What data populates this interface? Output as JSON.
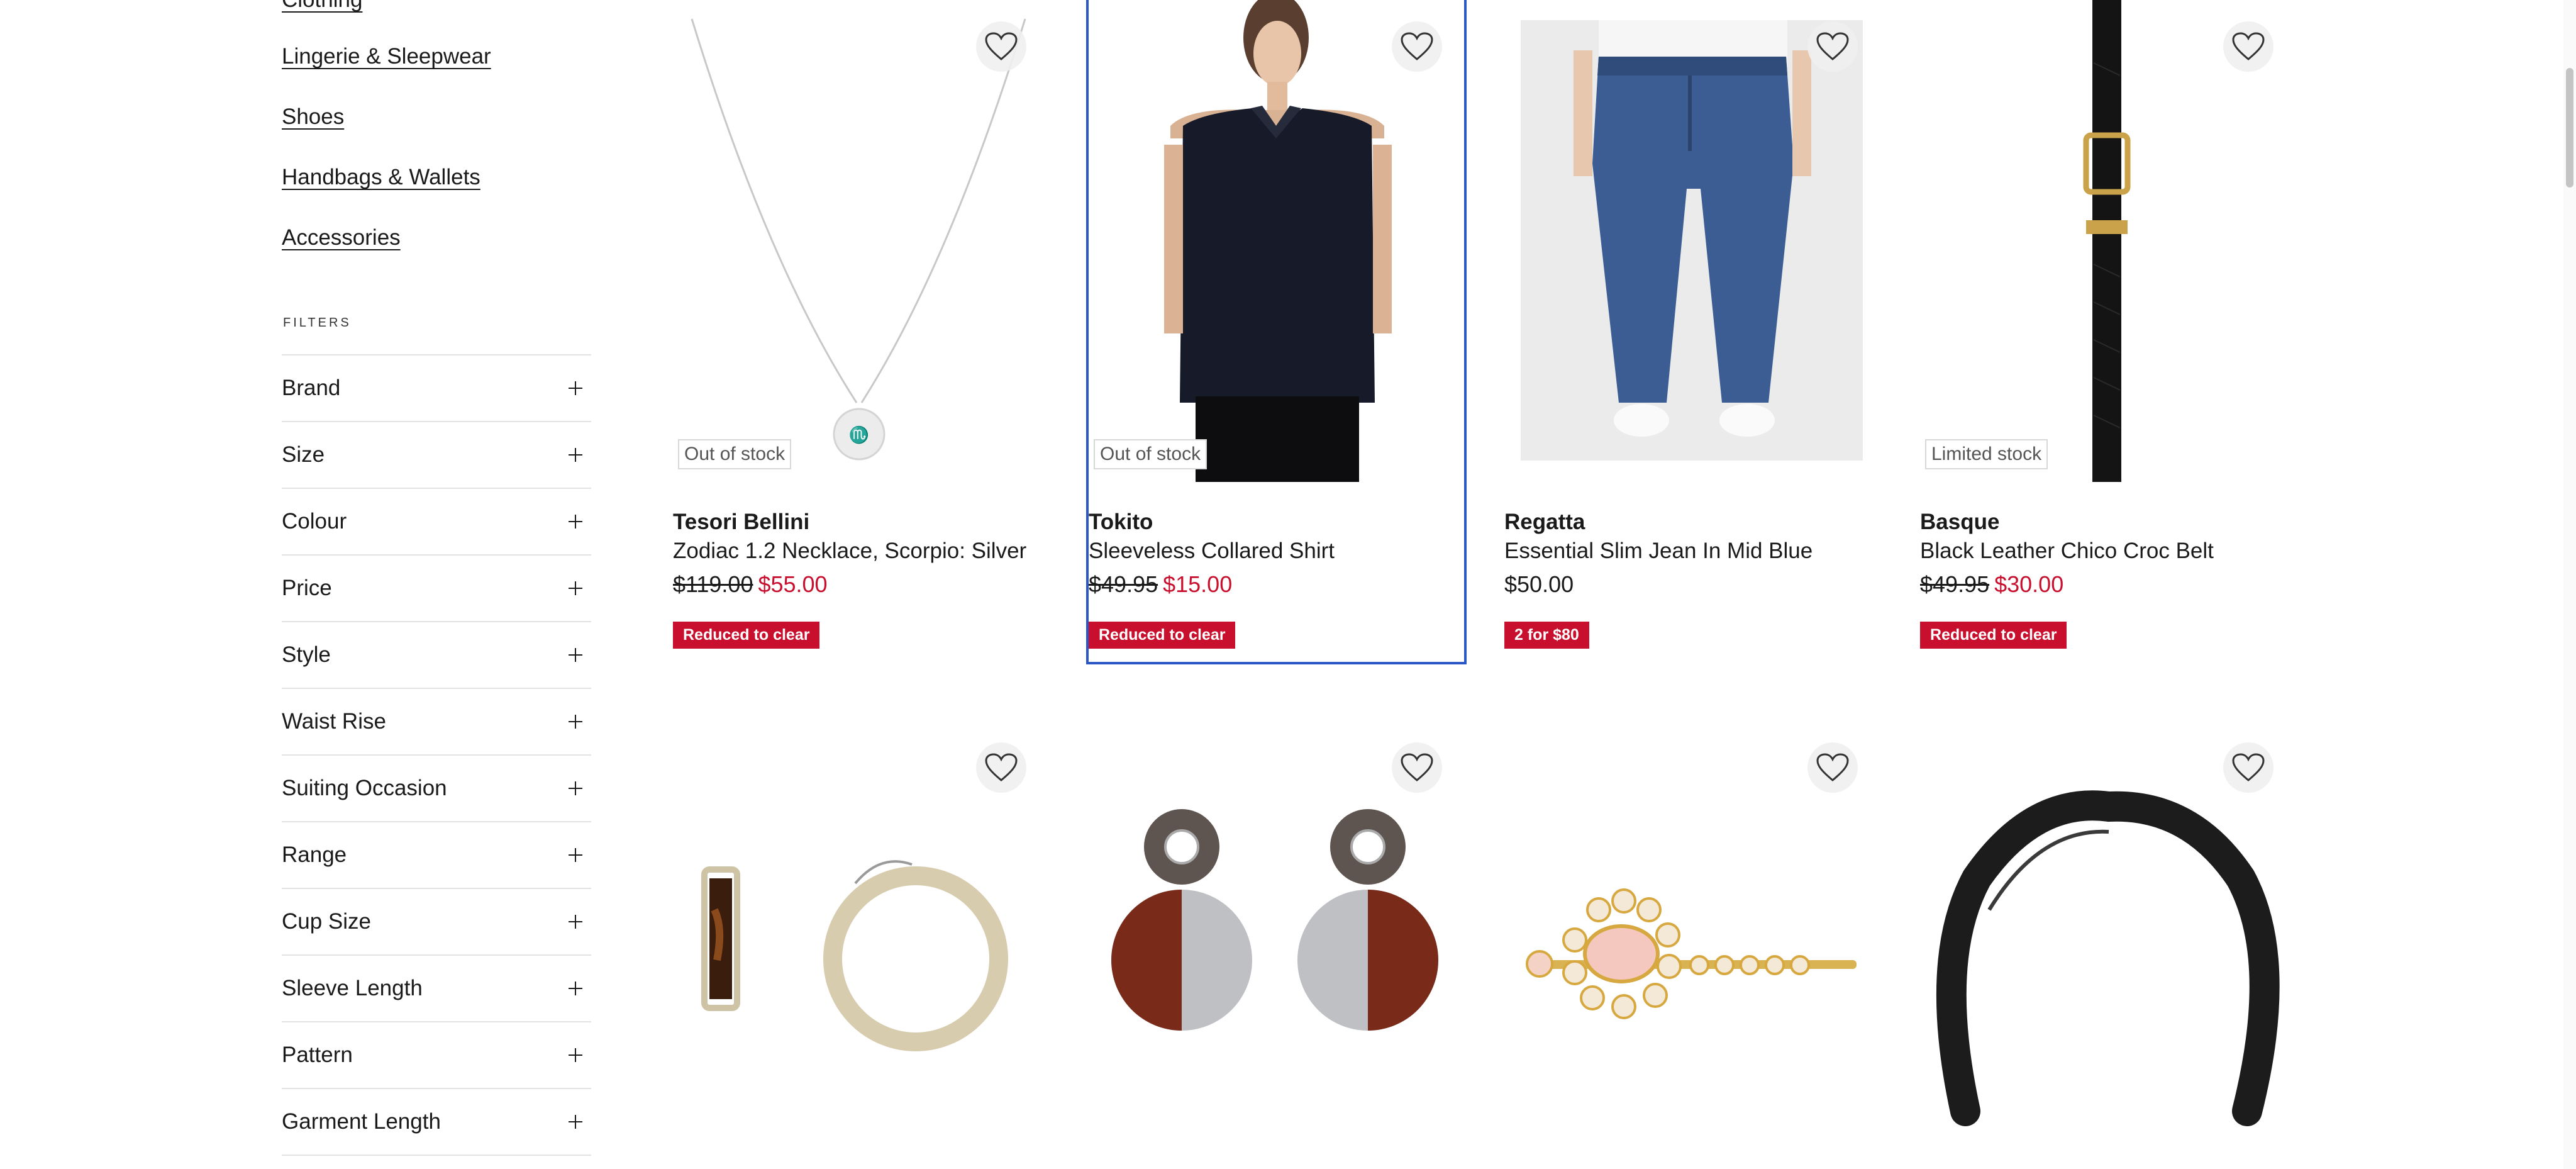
{
  "sidebar": {
    "categories": [
      "Clothing",
      "Lingerie & Sleepwear",
      "Shoes",
      "Handbags & Wallets",
      "Accessories"
    ],
    "filters_label": "FILTERS",
    "filters": [
      "Brand",
      "Size",
      "Colour",
      "Price",
      "Style",
      "Waist Rise",
      "Suiting Occasion",
      "Range",
      "Cup Size",
      "Sleeve Length",
      "Pattern",
      "Garment Length"
    ]
  },
  "products": [
    {
      "brand": "Tesori Bellini",
      "name": "Zodiac 1.2 Necklace, Scorpio: Silver",
      "was_price": "$119.00",
      "now_price": "$55.00",
      "stock": "Out of stock",
      "promo": "Reduced to clear",
      "image": "silver-pendant-necklace"
    },
    {
      "brand": "Tokito",
      "name": "Sleeveless Collared Shirt",
      "was_price": "$49.95",
      "now_price": "$15.00",
      "stock": "Out of stock",
      "promo": "Reduced to clear",
      "image": "navy-sleeveless-shirt"
    },
    {
      "brand": "Regatta",
      "name": "Essential Slim Jean In Mid Blue",
      "price": "$50.00",
      "promo": "2 for $80",
      "image": "blue-slim-jeans"
    },
    {
      "brand": "Basque",
      "name": "Black Leather Chico Croc Belt",
      "was_price": "$49.95",
      "now_price": "$30.00",
      "stock": "Limited stock",
      "promo": "Reduced to clear",
      "image": "black-croc-belt"
    },
    {
      "image": "tortoiseshell-hoop-earrings"
    },
    {
      "image": "red-silver-disc-earrings"
    },
    {
      "image": "pearl-jewel-hair-clip"
    },
    {
      "image": "black-padded-headband"
    }
  ],
  "colors": {
    "sale_red": "#c8102e",
    "focus_blue": "#2a56c6",
    "divider": "#e2e2e2"
  },
  "icons": {
    "wishlist": "heart-outline-icon",
    "expand": "plus-icon"
  }
}
